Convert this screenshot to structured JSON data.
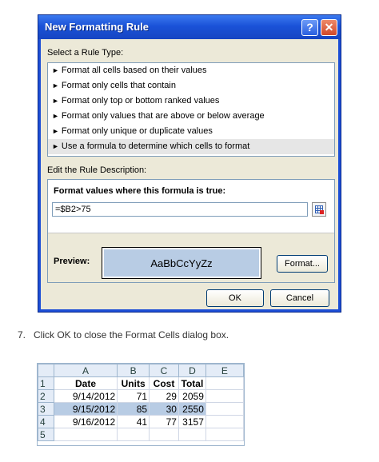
{
  "dialog": {
    "title": "New Formatting Rule",
    "help_label": "?",
    "close_label": "✕",
    "select_rule_type_label": "Select a Rule Type:",
    "rule_types": [
      "Format all cells based on their values",
      "Format only cells that contain",
      "Format only top or bottom ranked values",
      "Format only values that are above or below average",
      "Format only unique or duplicate values",
      "Use a formula to determine which cells to format"
    ],
    "selected_rule_index": 5,
    "edit_rule_label": "Edit the Rule Description:",
    "formula_heading": "Format values where this formula is true:",
    "formula_value": "=$B2>75",
    "preview_label": "Preview:",
    "preview_sample": "AaBbCcYyZz",
    "preview_fill": "#b8cce4",
    "format_button": "Format...",
    "ok_button": "OK",
    "cancel_button": "Cancel"
  },
  "instruction": {
    "number": "7.",
    "text": "Click OK to close the Format Cells dialog box."
  },
  "sheet": {
    "columns": [
      "A",
      "B",
      "C",
      "D",
      "E"
    ],
    "rows": [
      {
        "num": "1",
        "cells": [
          "Date",
          "Units",
          "Cost",
          "Total",
          ""
        ]
      },
      {
        "num": "2",
        "cells": [
          "9/14/2012",
          "71",
          "29",
          "2059",
          ""
        ]
      },
      {
        "num": "3",
        "cells": [
          "9/15/2012",
          "85",
          "30",
          "2550",
          ""
        ]
      },
      {
        "num": "4",
        "cells": [
          "9/16/2012",
          "41",
          "77",
          "3157",
          ""
        ]
      },
      {
        "num": "5",
        "cells": [
          "",
          "",
          "",
          "",
          ""
        ]
      }
    ],
    "highlighted_row": "3"
  }
}
